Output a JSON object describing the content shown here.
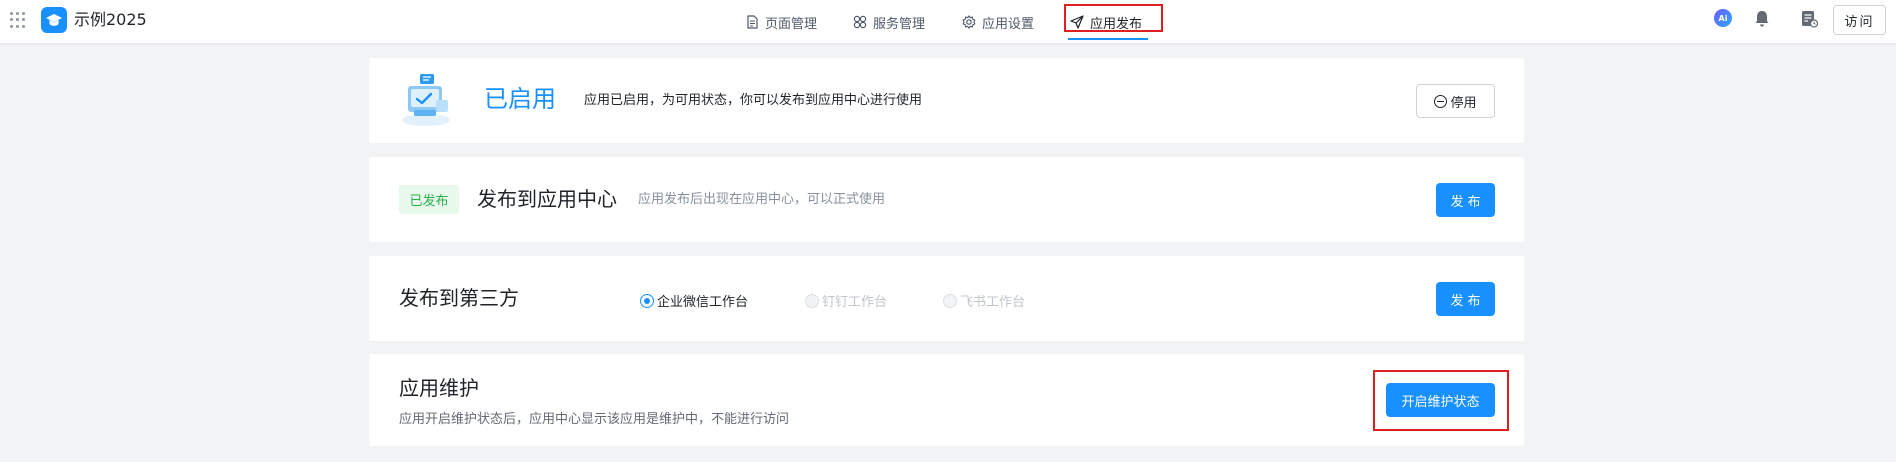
{
  "header": {
    "app_title": "示例2025",
    "nav": [
      {
        "label": "页面管理",
        "icon": "document-icon"
      },
      {
        "label": "服务管理",
        "icon": "services-icon"
      },
      {
        "label": "应用设置",
        "icon": "gear-icon"
      },
      {
        "label": "应用发布",
        "icon": "send-icon",
        "active": true
      }
    ],
    "ai_label": "Ai",
    "visit_label": "访问"
  },
  "status_card": {
    "title": "已启用",
    "description": "应用已启用，为可用状态，你可以发布到应用中心进行使用",
    "stop_label": "停用"
  },
  "publish_center": {
    "badge": "已发布",
    "title": "发布到应用中心",
    "description": "应用发布后出现在应用中心，可以正式使用",
    "button": "发布"
  },
  "third_party": {
    "title": "发布到第三方",
    "options": [
      {
        "label": "企业微信工作台",
        "checked": true,
        "disabled": false
      },
      {
        "label": "钉钉工作台",
        "checked": false,
        "disabled": true
      },
      {
        "label": "飞书工作台",
        "checked": false,
        "disabled": true
      }
    ],
    "button": "发布"
  },
  "maintenance": {
    "title": "应用维护",
    "description": "应用开启维护状态后，应用中心显示该应用是维护中，不能进行访问",
    "button": "开启维护状态"
  },
  "colors": {
    "primary": "#1890ff",
    "success": "#27b14a",
    "highlight": "#e02020"
  }
}
